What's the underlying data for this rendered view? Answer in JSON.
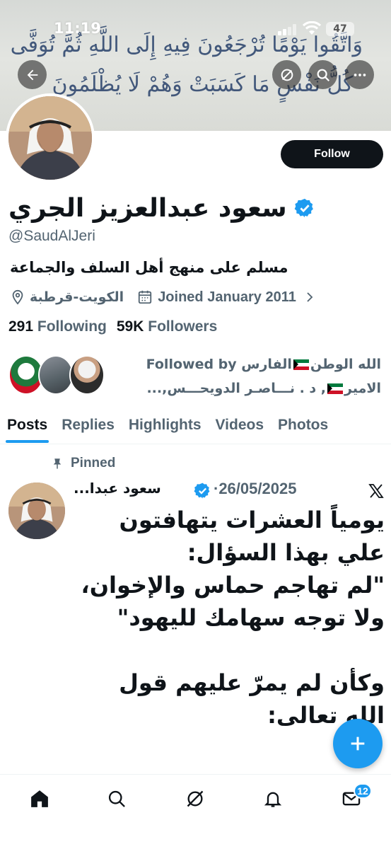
{
  "status_bar": {
    "time": "11:19",
    "battery": "47"
  },
  "banner": {
    "line1": "وَاتَّقُوا يَوْمًا تُرْجَعُونَ فِيهِ إِلَى اللَّهِ ثُمَّ تُوَفَّى",
    "line2": "كُلُّ نَفْسٍ مَا كَسَبَتْ وَهُمْ لَا يُظْلَمُونَ"
  },
  "profile": {
    "name": "سعود عبدالعزيز الجري",
    "handle": "@SaudAlJeri",
    "bio": "مسلم على منهج أهل السلف والجماعة",
    "location": "الكويت-قرطبة",
    "joined": "Joined January 2011",
    "following_count": "291",
    "following_label": "Following",
    "followers_count": "59K",
    "followers_label": "Followers",
    "follow_button": "Follow",
    "followed_by_prefix": "Followed by",
    "followed_by_name1": "الله الوطن",
    "followed_by_name2": "الفارس",
    "followed_by_name3": "الامير",
    "followed_by_rest": ", د . نـــاصـر الدويحـــس,..."
  },
  "tabs": [
    "Posts",
    "Replies",
    "Highlights",
    "Videos",
    "Photos"
  ],
  "pinned_post": {
    "pinned_label": "Pinned",
    "author": "سعود عبدا...",
    "date": "·26/05/2025",
    "body": "يومياً العشرات يتهافتون علي بهذا السؤال:\n\"لم تهاجم حماس والإخوان، ولا توجه سهامك لليهود\"\n\nوكأن لم يمرّ عليهم قول الله تعالى:"
  },
  "bottom_nav": {
    "messages_badge": "12"
  },
  "colors": {
    "accent": "#1d9bf0",
    "text": "#0f1419",
    "muted": "#536471"
  }
}
